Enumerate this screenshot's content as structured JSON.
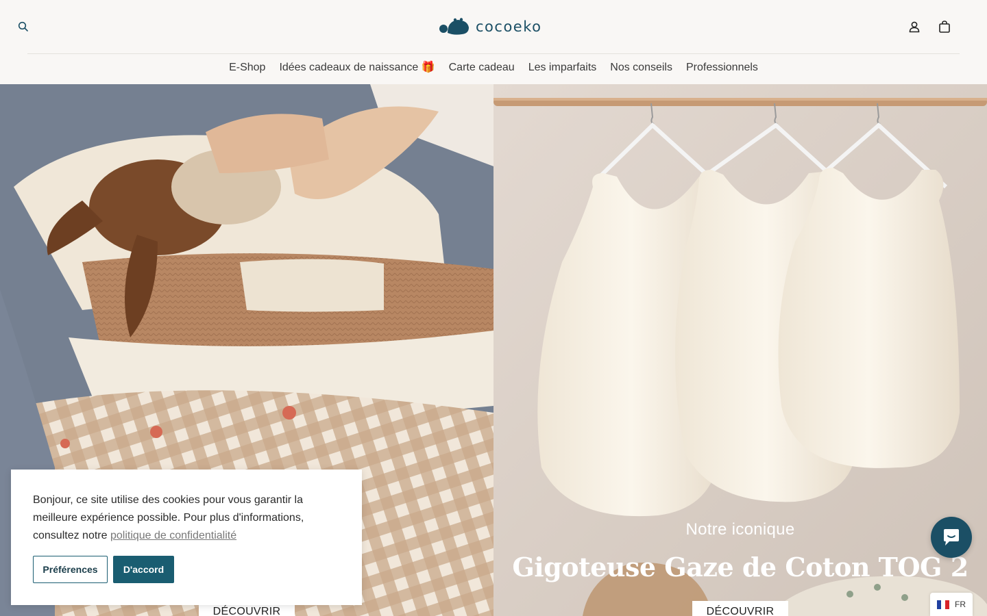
{
  "header": {
    "brand": "cocoeko",
    "nav": [
      "E-Shop",
      "Idées cadeaux de naissance 🎁",
      "Carte cadeau",
      "Les imparfaits",
      "Nos conseils",
      "Professionnels"
    ]
  },
  "hero": {
    "left": {
      "button": "DÉCOUVRIR"
    },
    "right": {
      "subtitle": "Notre iconique",
      "title": "Gigoteuse Gaze de Coton TOG 2",
      "button": "DÉCOUVRIR"
    }
  },
  "cookie": {
    "text": "Bonjour, ce site utilise des cookies pour vous garantir la meilleure expérience possible. Pour plus d'informations, consultez notre",
    "link": "politique de confidentialité",
    "preferences": "Préférences",
    "accept": "D'accord"
  },
  "language": {
    "code": "FR"
  },
  "colors": {
    "brand": "#1b4f65",
    "accent": "#1a5d71"
  }
}
